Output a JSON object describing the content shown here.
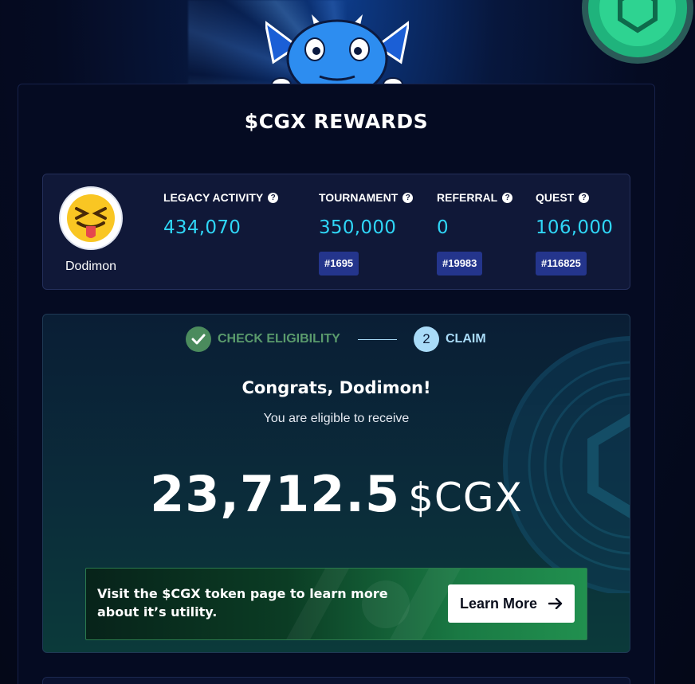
{
  "header": {
    "title": "$CGX REWARDS"
  },
  "profile": {
    "username": "Dodimon"
  },
  "stats": [
    {
      "label": "LEGACY ACTIVITY",
      "value": "434,070",
      "rank": ""
    },
    {
      "label": "TOURNAMENT",
      "value": "350,000",
      "rank": "#1695"
    },
    {
      "label": "REFERRAL",
      "value": "0",
      "rank": "#19983"
    },
    {
      "label": "QUEST",
      "value": "106,000",
      "rank": "#116825"
    }
  ],
  "help_glyph": "?",
  "steps": {
    "step1_label": "CHECK ELIGIBILITY",
    "step2_number": "2",
    "step2_label": "CLAIM"
  },
  "claim": {
    "congrats": "Congrats, Dodimon!",
    "eligible_text": "You are eligible to receive",
    "amount": "23,712.5",
    "unit": "$CGX"
  },
  "promo": {
    "text": "Visit the $CGX token page to learn more about it’s utility.",
    "button_label": "Learn More"
  },
  "colors": {
    "accent_cyan": "#2fd6f7",
    "badge_blue": "#24358c",
    "step_done_green": "#4b8b5d",
    "step_active_blue": "#a9dbf8"
  },
  "icons": {
    "mascot": "dragon-mascot-icon",
    "coin": "cgx-coin-icon",
    "avatar": "squinting-tongue-emoji-icon",
    "check": "check-icon",
    "arrow": "arrow-right-icon"
  }
}
